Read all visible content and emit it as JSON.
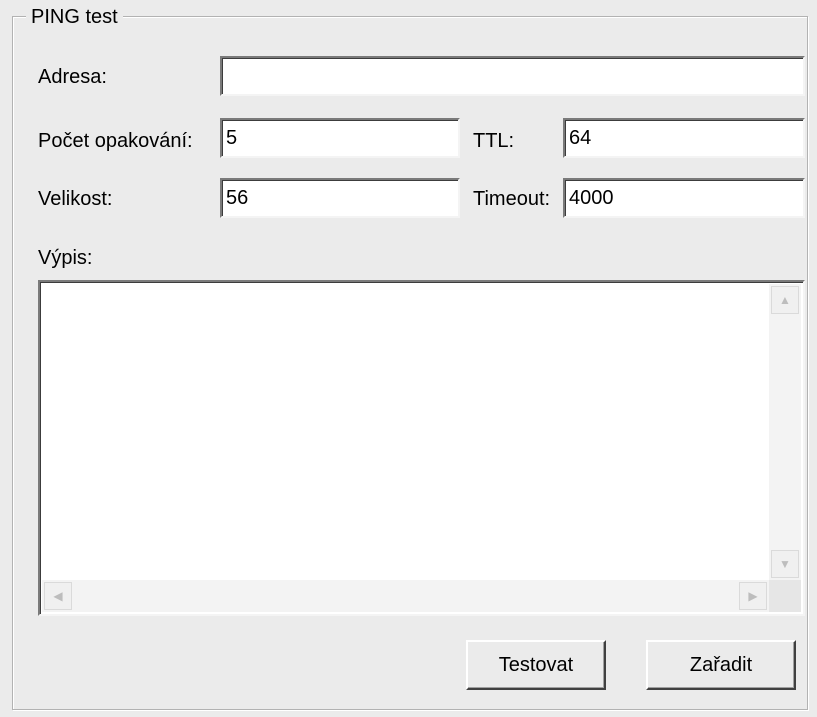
{
  "group": {
    "title": "PING test"
  },
  "address": {
    "label": "Adresa:",
    "value": ""
  },
  "count": {
    "label": "Počet opakování:",
    "value": "5"
  },
  "ttl": {
    "label": "TTL:",
    "value": "64"
  },
  "size": {
    "label": "Velikost:",
    "value": "56"
  },
  "timeout": {
    "label": "Timeout:",
    "value": "4000"
  },
  "output": {
    "label": "Výpis:",
    "value": ""
  },
  "scroll_icons": {
    "up": "scroll-up-arrow",
    "down": "scroll-down-arrow",
    "left": "scroll-left-arrow",
    "right": "scroll-right-arrow"
  },
  "buttons": {
    "test": "Testovat",
    "enqueue": "Zařadit"
  }
}
